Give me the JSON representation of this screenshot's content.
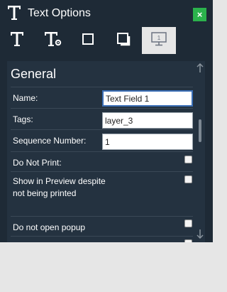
{
  "window": {
    "title": "Text Options",
    "close_label": "×"
  },
  "tabs": [
    {
      "icon": "text-icon",
      "active": false
    },
    {
      "icon": "text-settings-icon",
      "active": false
    },
    {
      "icon": "square-outline-icon",
      "active": false
    },
    {
      "icon": "shadow-box-icon",
      "active": false
    },
    {
      "icon": "monitor-icon",
      "active": true,
      "badge": "1"
    }
  ],
  "section": {
    "heading": "General",
    "fields": {
      "name": {
        "label": "Name:",
        "value": "Text Field 1"
      },
      "tags": {
        "label": "Tags:",
        "value": "layer_3"
      },
      "sequence": {
        "label": "Sequence Number:",
        "value": "1"
      }
    },
    "checkboxes": {
      "do_not_print": {
        "label": "Do Not Print:",
        "checked": false
      },
      "show_in_preview": {
        "label": "Show in Preview despite not being printed",
        "checked": false
      },
      "do_not_open_popup": {
        "label": "Do not open popup",
        "checked": false
      }
    }
  },
  "colors": {
    "panel_bg": "#1e2a36",
    "content_bg": "#243240",
    "close_green": "#2bb24c",
    "page_bg": "#e6e6e6"
  }
}
